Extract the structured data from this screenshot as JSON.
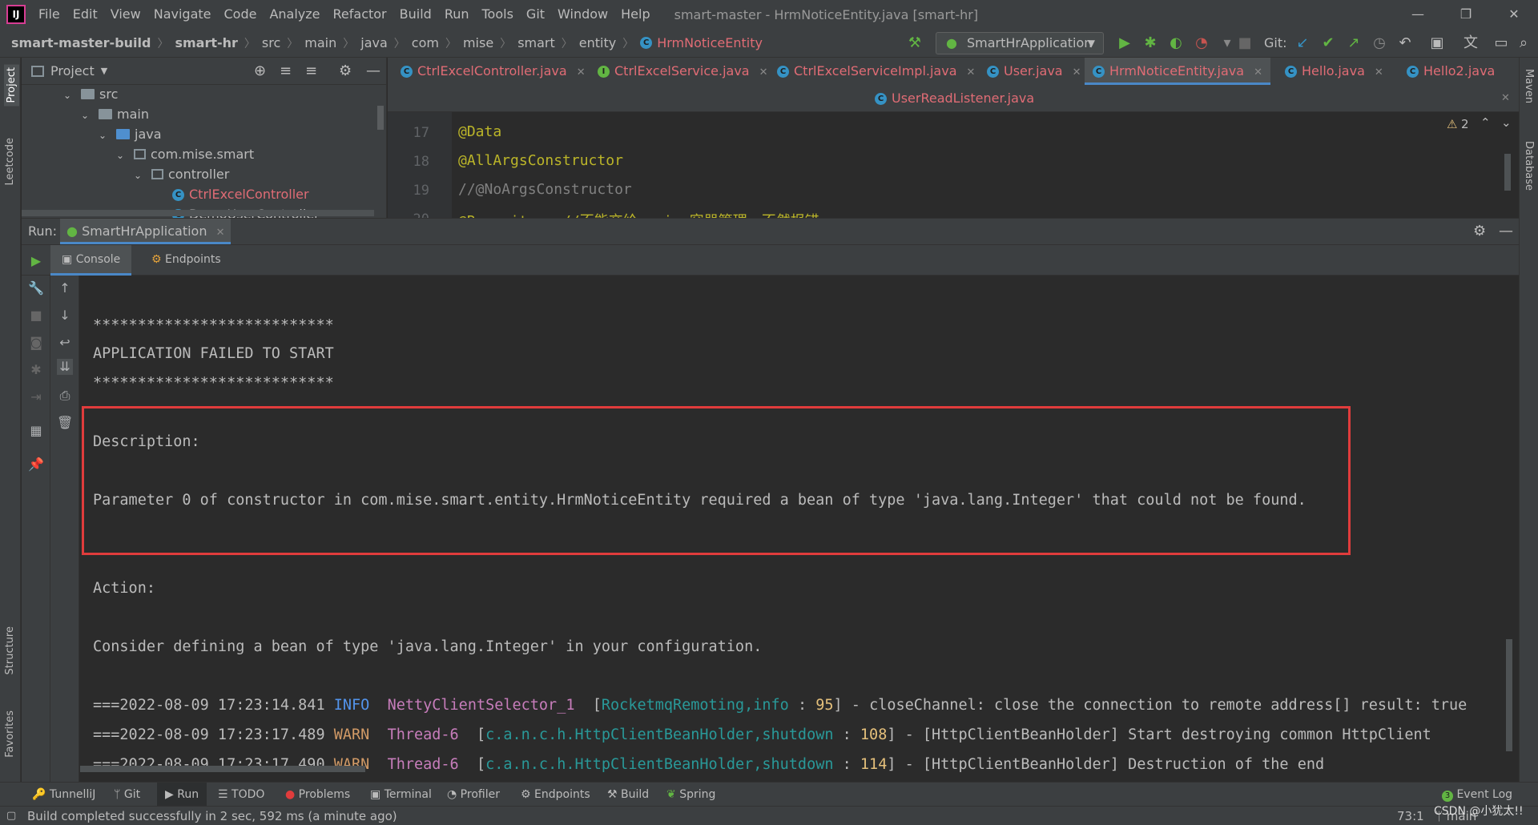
{
  "menu": {
    "logo": "IJ",
    "items": [
      "File",
      "Edit",
      "View",
      "Navigate",
      "Code",
      "Analyze",
      "Refactor",
      "Build",
      "Run",
      "Tools",
      "Git",
      "Window",
      "Help"
    ],
    "window_title": "smart-master - HrmNoticeEntity.java [smart-hr]",
    "controls": {
      "minimize": "—",
      "restore": "❐",
      "close": "✕"
    }
  },
  "breadcrumb": [
    "smart-master-build",
    "smart-hr",
    "src",
    "main",
    "java",
    "com",
    "mise",
    "smart",
    "entity",
    "HrmNoticeEntity"
  ],
  "toolbar": {
    "run_config": "SmartHrApplication",
    "git_label": "Git:"
  },
  "left_stripe": {
    "project": "Project",
    "leetcode": "Leetcode",
    "structure": "Structure",
    "favorites": "Favorites"
  },
  "right_stripe": {
    "maven": "Maven",
    "database": "Database"
  },
  "project_panel": {
    "title": "Project",
    "tree": [
      {
        "label": "src",
        "depth": 0,
        "kind": "folder"
      },
      {
        "label": "main",
        "depth": 1,
        "kind": "folder"
      },
      {
        "label": "java",
        "depth": 2,
        "kind": "folder-blue"
      },
      {
        "label": "com.mise.smart",
        "depth": 3,
        "kind": "package"
      },
      {
        "label": "controller",
        "depth": 4,
        "kind": "package"
      },
      {
        "label": "CtrlExcelController",
        "depth": 5,
        "kind": "class-error"
      },
      {
        "label": "DemoUserController",
        "depth": 5,
        "kind": "class"
      }
    ]
  },
  "editor": {
    "tabs_row1": [
      "CtrlExcelController.java",
      "CtrlExcelService.java",
      "CtrlExcelServiceImpl.java",
      "User.java",
      "HrmNoticeEntity.java",
      "Hello.java",
      "Hello2.java"
    ],
    "tabs_row2": [
      "UserReadListener.java"
    ],
    "active_tab": "HrmNoticeEntity.java",
    "warnings": "2",
    "lines": [
      {
        "num": "17",
        "text": "@Data",
        "kind": "anno"
      },
      {
        "num": "18",
        "text": "@AllArgsConstructor",
        "kind": "anno"
      },
      {
        "num": "19",
        "text": "//@NoArgsConstructor",
        "kind": "comment"
      },
      {
        "num": "20",
        "text": "@Repository   //不能交给spring容器管理，不然报错",
        "kind": "anno"
      }
    ]
  },
  "run_panel": {
    "label": "Run:",
    "tab": "SmartHrApplication",
    "subtabs": [
      "Console",
      "Endpoints"
    ]
  },
  "console": {
    "stars": "***************************",
    "failed": "APPLICATION FAILED TO START",
    "description_label": "Description:",
    "description_text": "Parameter 0 of constructor in com.mise.smart.entity.HrmNoticeEntity required a bean of type 'java.lang.Integer' that could not be found.",
    "action_label": "Action:",
    "action_text": "Consider defining a bean of type 'java.lang.Integer' in your configuration.",
    "logs": [
      {
        "prefix": "===2022-08-09 17:23:14.841 ",
        "level": "INFO",
        "thread": "NettyClientSelector_1",
        "pad": "  ",
        "loc": "RocketmqRemoting,info",
        "line": "95",
        "msg": "] - closeChannel: close the connection to remote address[] result: true"
      },
      {
        "prefix": "===2022-08-09 17:23:17.489 ",
        "level": "WARN",
        "thread": "Thread-6",
        "pad": "  ",
        "loc": "c.a.n.c.h.HttpClientBeanHolder,shutdown",
        "line": "108",
        "msg": "] - [HttpClientBeanHolder] Start destroying common HttpClient"
      },
      {
        "prefix": "===2022-08-09 17:23:17.490 ",
        "level": "WARN",
        "thread": "Thread-6",
        "pad": "  ",
        "loc": "c.a.n.c.h.HttpClientBeanHolder,shutdown",
        "line": "114",
        "msg": "] - [HttpClientBeanHolder] Destruction of the end"
      }
    ]
  },
  "bottom_tools": [
    "TunnelliJ",
    "Git",
    "Run",
    "TODO",
    "Problems",
    "Terminal",
    "Profiler",
    "Endpoints",
    "Build",
    "Spring"
  ],
  "event_log": {
    "count": "3",
    "label": "Event Log"
  },
  "status": {
    "message": "Build completed successfully in 2 sec, 592 ms (a minute ago)",
    "position": "73:1",
    "branch": "main",
    "watermark": "CSDN @小犹太!!"
  },
  "colors": {
    "error_box": "#e03c3c",
    "accent": "#4a88c7",
    "annotation": "#bbb529"
  }
}
